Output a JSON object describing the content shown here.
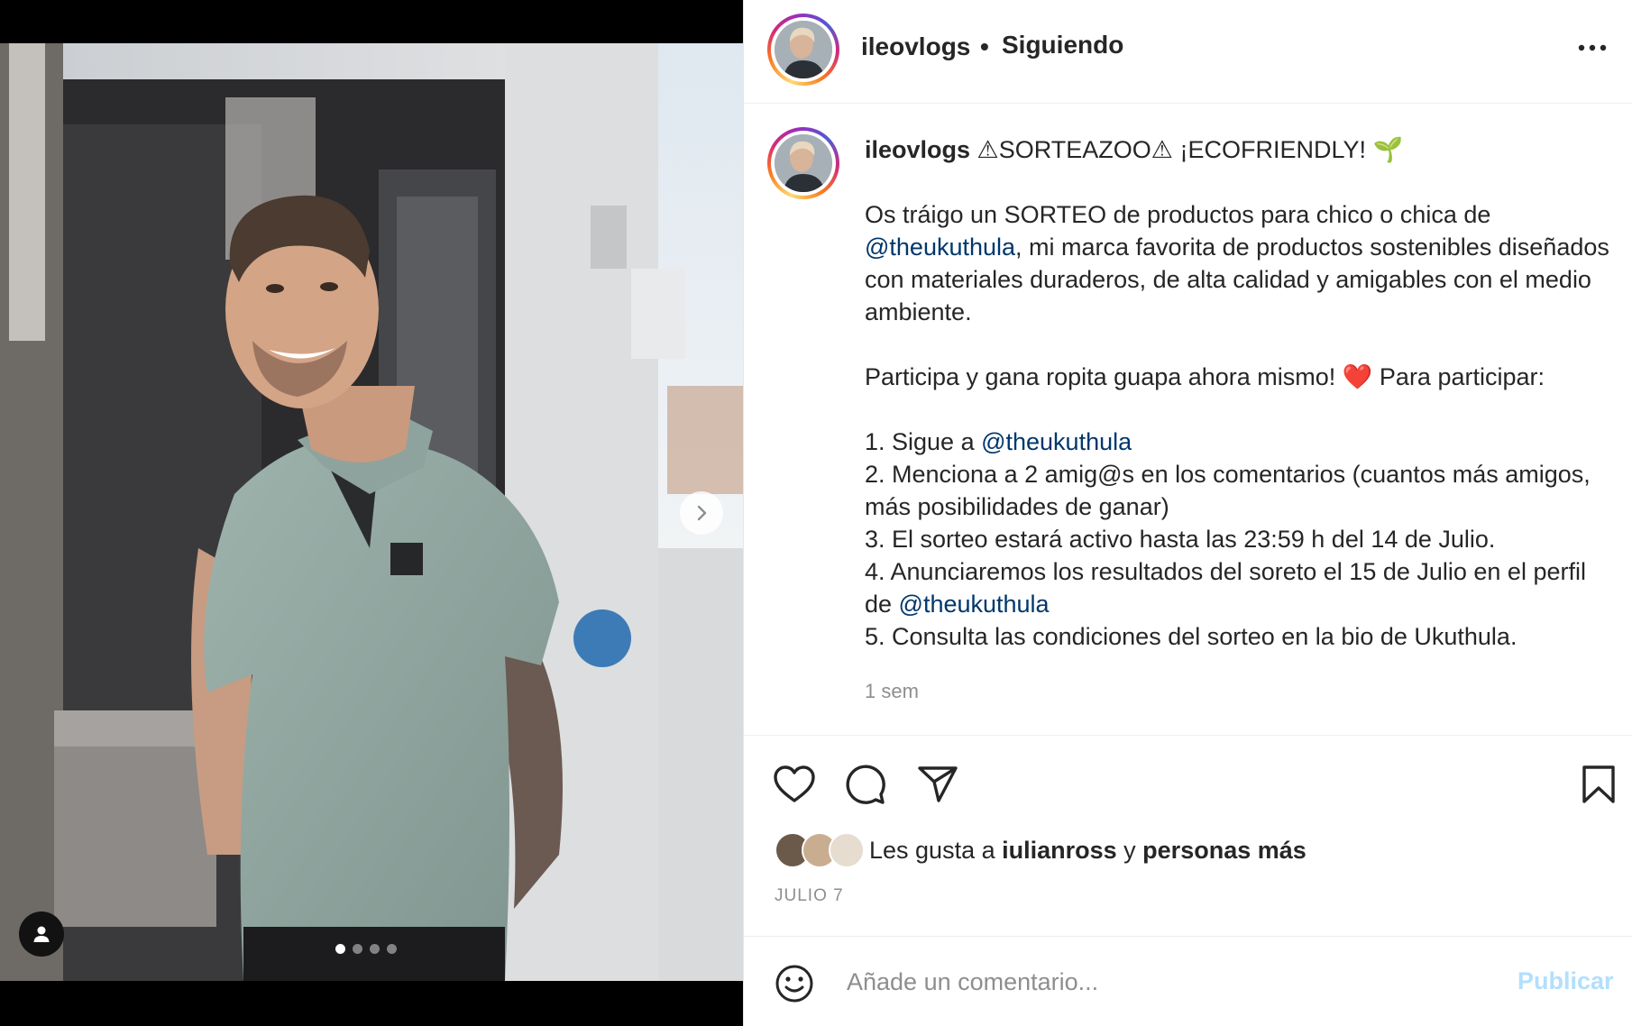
{
  "post": {
    "username": "ileovlogs",
    "separator": "•",
    "follow_status": "Siguiendo",
    "more_icon": "more-horizontal-icon"
  },
  "caption": {
    "username": "ileovlogs",
    "title": "⚠SORTEAZOO⚠ ¡ECOFRIENDLY! 🌱",
    "intro_1": "Os tráigo un SORTEO de productos para chico o chica de ",
    "mention_1": "@theukuthula",
    "intro_2": ", mi marca favorita de productos sostenibles diseñados con materiales duraderos, de alta calidad y amigables con el medio ambiente.",
    "participate": "Participa y gana ropita guapa ahora mismo! ❤️ Para participar:",
    "step_1_prefix": "1. Sigue a ",
    "step_1_mention": "@theukuthula",
    "step_2": "2. Menciona a 2 amig@s en los comentarios (cuantos más amigos, más posibilidades de ganar)",
    "step_3": "3. El sorteo estará activo hasta las 23:59 h del 14 de Julio.",
    "step_4_prefix": "4. Anunciaremos los resultados del soreto el 15 de Julio en el perfil de ",
    "step_4_mention": "@theukuthula",
    "step_5": "5. Consulta las condiciones del sorteo en la bio de Ukuthula.",
    "time": "1 sem"
  },
  "actions": {
    "like_icon": "heart-icon",
    "comment_icon": "comment-icon",
    "share_icon": "paper-plane-icon",
    "save_icon": "bookmark-icon"
  },
  "likes": {
    "prefix": "Les gusta a ",
    "user": "iulianross",
    "connector": " y ",
    "rest": "personas más"
  },
  "date": "JULIO 7",
  "comment": {
    "placeholder": "Añade un comentario...",
    "publish_label": "Publicar",
    "emoji_icon": "smiley-icon"
  },
  "carousel": {
    "total": 4,
    "active": 1,
    "next_icon": "chevron-right-icon",
    "tag_icon": "user-tag-icon"
  },
  "colors": {
    "link": "#00376b",
    "publish_disabled": "#b2dffc",
    "muted": "#8e8e8e",
    "text": "#262626"
  }
}
